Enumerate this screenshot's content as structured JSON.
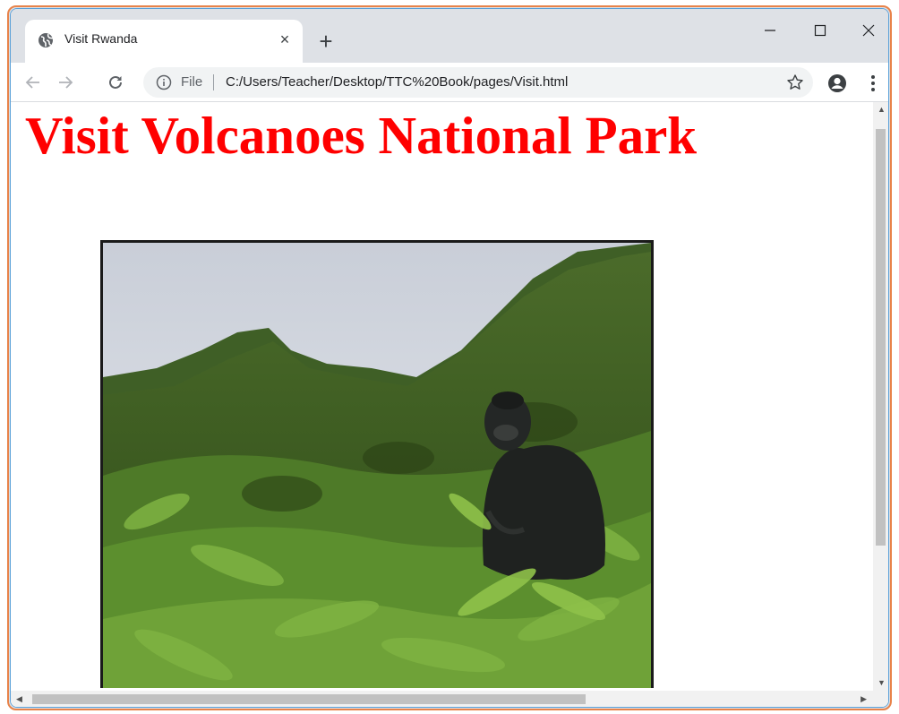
{
  "window": {
    "tab": {
      "title": "Visit Rwanda",
      "favicon": "globe-icon",
      "close_label": "×"
    },
    "new_tab_label": "+",
    "controls": {
      "minimize": "minimize-icon",
      "maximize": "maximize-icon",
      "close": "close-icon"
    }
  },
  "toolbar": {
    "back_icon": "back-arrow-icon",
    "forward_icon": "forward-arrow-icon",
    "reload_icon": "reload-icon",
    "address": {
      "scheme_label": "File",
      "url": "C:/Users/Teacher/Desktop/TTC%20Book/pages/Visit.html"
    }
  },
  "page": {
    "heading": "Visit Volcanoes National Park",
    "image": {
      "subject": "mountain gorilla in green ferns on volcanic hillside"
    }
  },
  "colors": {
    "heading": "#ff0000",
    "tabstrip": "#dee1e6",
    "frame_accent": "#e8834a"
  }
}
